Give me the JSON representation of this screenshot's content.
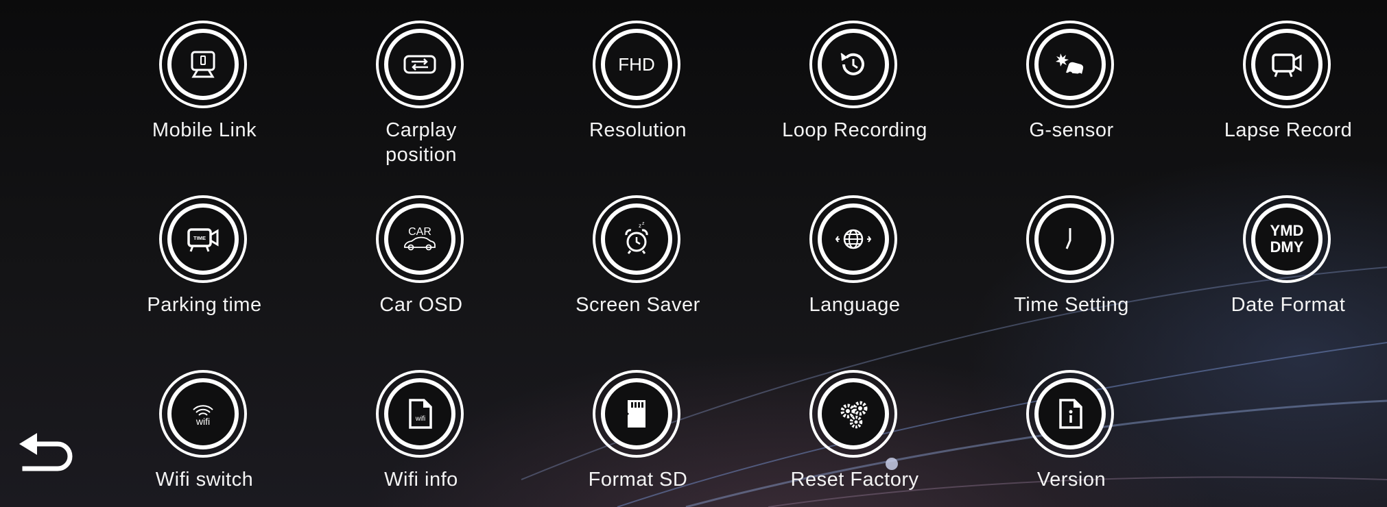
{
  "menu": {
    "items": [
      {
        "label": "Mobile Link",
        "icon": "mobile-link-icon"
      },
      {
        "label": "Carplay\nposition",
        "icon": "carplay-position-icon"
      },
      {
        "label": "Resolution",
        "icon": "resolution-icon",
        "icon_text": "FHD"
      },
      {
        "label": "Loop Recording",
        "icon": "loop-recording-icon"
      },
      {
        "label": "G-sensor",
        "icon": "g-sensor-icon"
      },
      {
        "label": "Lapse Record",
        "icon": "lapse-record-icon"
      },
      {
        "label": "Parking time",
        "icon": "parking-time-icon",
        "icon_text": "TIME"
      },
      {
        "label": "Car OSD",
        "icon": "car-osd-icon",
        "icon_text": "CAR"
      },
      {
        "label": "Screen Saver",
        "icon": "screen-saver-icon"
      },
      {
        "label": "Language",
        "icon": "language-icon"
      },
      {
        "label": "Time Setting",
        "icon": "time-setting-icon"
      },
      {
        "label": "Date Format",
        "icon": "date-format-icon",
        "icon_text": "YMD\nDMY"
      },
      {
        "label": "Wifi switch",
        "icon": "wifi-switch-icon",
        "icon_text": "wifi"
      },
      {
        "label": "Wifi info",
        "icon": "wifi-info-icon",
        "icon_text": "wifi"
      },
      {
        "label": "Format SD",
        "icon": "format-sd-icon"
      },
      {
        "label": "Reset Factory",
        "icon": "reset-factory-icon"
      },
      {
        "label": "Version",
        "icon": "version-icon"
      }
    ]
  },
  "back": {
    "icon": "back-arrow-icon"
  },
  "colors": {
    "background": "#101012",
    "foreground": "#ffffff",
    "accent_line": "#8fa3d6"
  }
}
